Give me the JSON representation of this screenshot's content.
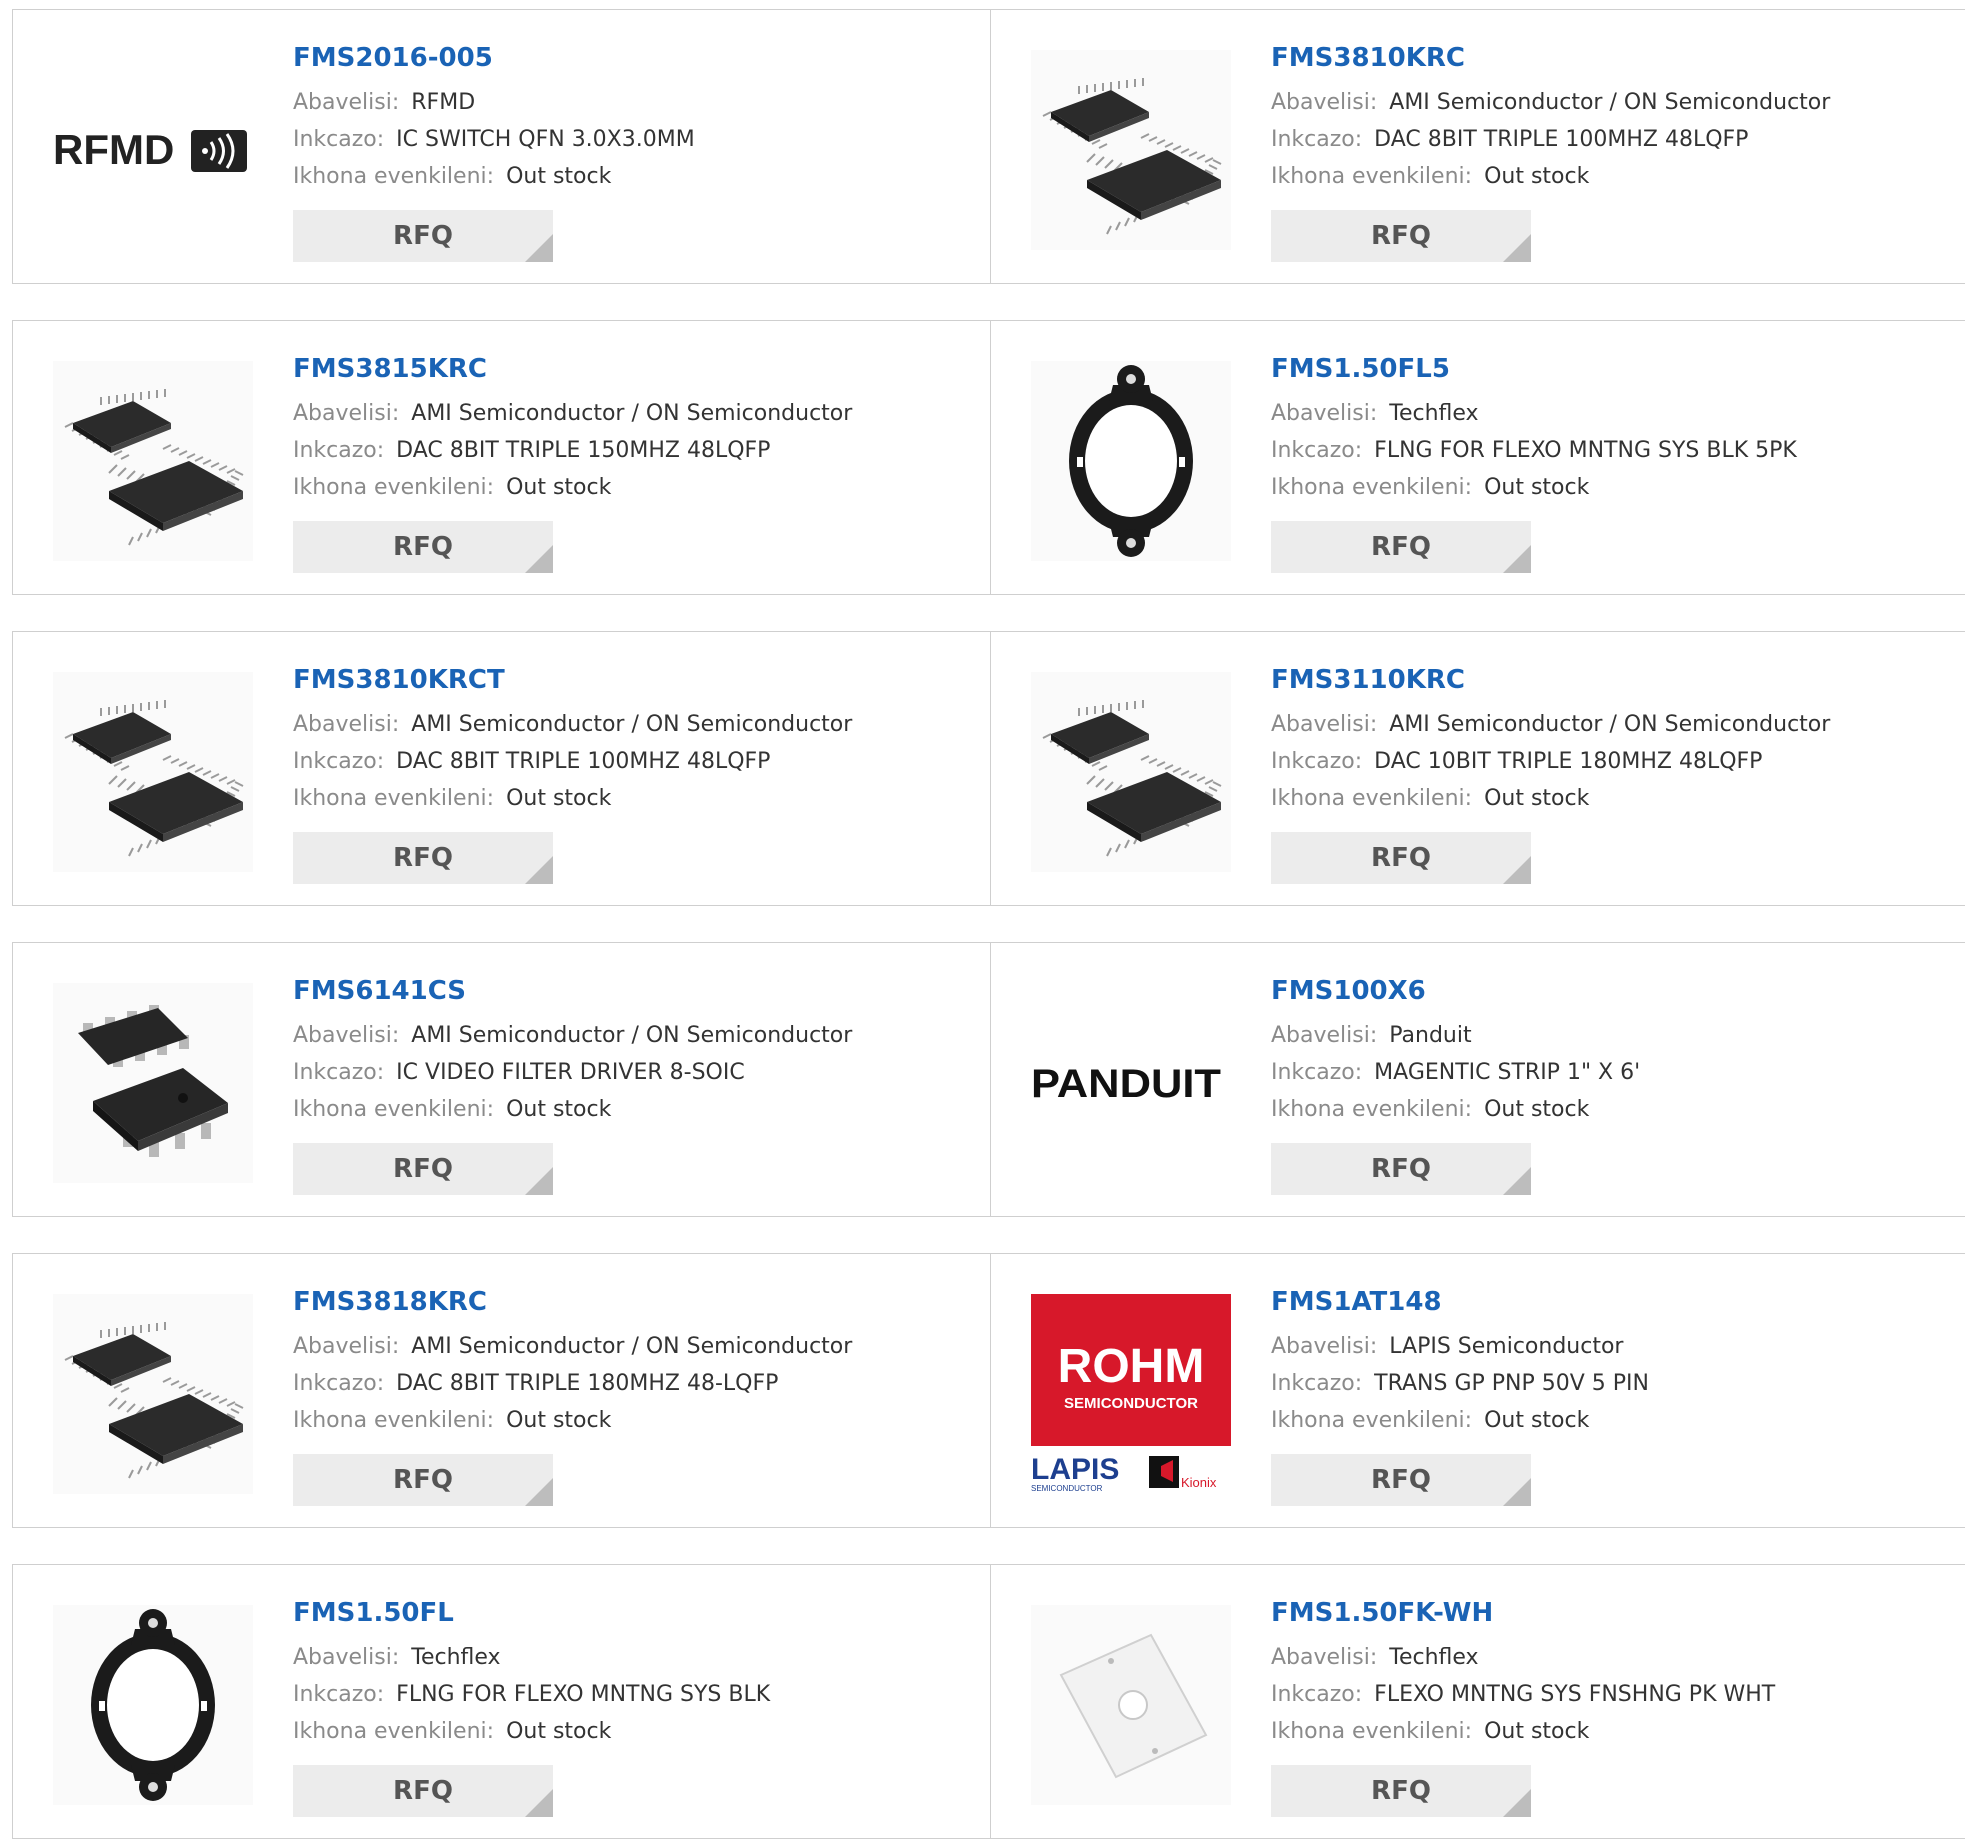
{
  "labels": {
    "manufacturer": "Abavelisi:",
    "description": "Inkcazo:",
    "stock": "Ikhona evenkileni:",
    "rfq": "RFQ"
  },
  "products": [
    {
      "part": "FMS2016-005",
      "manufacturer": "RFMD",
      "description": "IC SWITCH QFN 3.0X3.0MM",
      "stock": "Out stock",
      "image": "rfmd-logo"
    },
    {
      "part": "FMS3810KRC",
      "manufacturer": "AMI Semiconductor / ON Semiconductor",
      "description": "DAC 8BIT TRIPLE 100MHZ 48LQFP",
      "stock": "Out stock",
      "image": "lqfp-chip"
    },
    {
      "part": "FMS3815KRC",
      "manufacturer": "AMI Semiconductor / ON Semiconductor",
      "description": "DAC 8BIT TRIPLE 150MHZ 48LQFP",
      "stock": "Out stock",
      "image": "lqfp-chip"
    },
    {
      "part": "FMS1.50FL5",
      "manufacturer": "Techflex",
      "description": "FLNG FOR FLEXO MNTNG SYS BLK 5PK",
      "stock": "Out stock",
      "image": "flange-ring"
    },
    {
      "part": "FMS3810KRCT",
      "manufacturer": "AMI Semiconductor / ON Semiconductor",
      "description": "DAC 8BIT TRIPLE 100MHZ 48LQFP",
      "stock": "Out stock",
      "image": "lqfp-chip"
    },
    {
      "part": "FMS3110KRC",
      "manufacturer": "AMI Semiconductor / ON Semiconductor",
      "description": "DAC 10BIT TRIPLE 180MHZ 48LQFP",
      "stock": "Out stock",
      "image": "lqfp-chip"
    },
    {
      "part": "FMS6141CS",
      "manufacturer": "AMI Semiconductor / ON Semiconductor",
      "description": "IC VIDEO FILTER DRIVER 8-SOIC",
      "stock": "Out stock",
      "image": "soic-chip"
    },
    {
      "part": "FMS100X6",
      "manufacturer": "Panduit",
      "description": "MAGENTIC STRIP 1\" X 6'",
      "stock": "Out stock",
      "image": "panduit-logo"
    },
    {
      "part": "FMS3818KRC",
      "manufacturer": "AMI Semiconductor / ON Semiconductor",
      "description": "DAC 8BIT TRIPLE 180MHZ 48-LQFP",
      "stock": "Out stock",
      "image": "lqfp-chip"
    },
    {
      "part": "FMS1AT148",
      "manufacturer": "LAPIS Semiconductor",
      "description": "TRANS GP PNP 50V 5 PIN",
      "stock": "Out stock",
      "image": "rohm-logo"
    },
    {
      "part": "FMS1.50FL",
      "manufacturer": "Techflex",
      "description": "FLNG FOR FLEXO MNTNG SYS BLK",
      "stock": "Out stock",
      "image": "flange-ring"
    },
    {
      "part": "FMS1.50FK-WH",
      "manufacturer": "Techflex",
      "description": "FLEXO MNTNG SYS FNSHNG PK WHT",
      "stock": "Out stock",
      "image": "white-plate"
    }
  ],
  "logos": {
    "rfmd": "RFMD",
    "panduit": "PANDUIT",
    "rohm": "ROHM",
    "rohm_sub": "SEMICONDUCTOR",
    "lapis": "LAPIS",
    "lapis_sub": "SEMICONDUCTOR",
    "kionix": "Kionix"
  },
  "colors": {
    "part_link": "#1a63b5",
    "label": "#8a8a8a",
    "value": "#333333",
    "rfq_bg": "#ececec",
    "rohm_red": "#d7182a",
    "lapis_blue": "#1d3f8f"
  }
}
